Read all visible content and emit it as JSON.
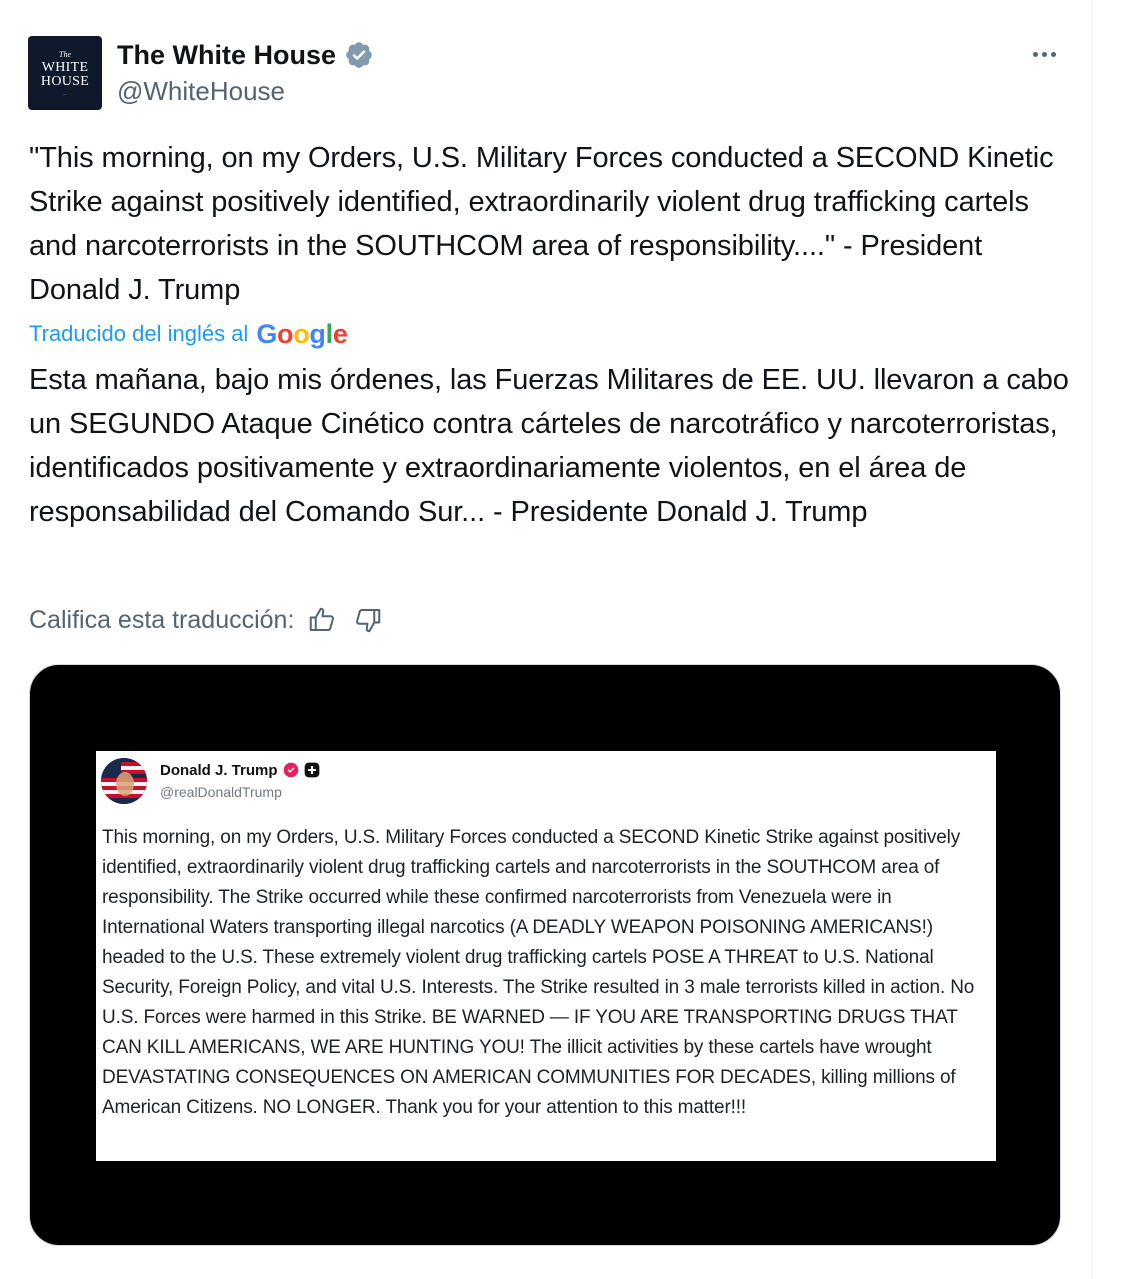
{
  "account": {
    "display_name": "The White House",
    "handle": "@WhiteHouse",
    "avatar_lines": [
      "The",
      "WHITE",
      "HOUSE"
    ],
    "verified_icon": "verified-badge-icon",
    "verified_color": "#829aab"
  },
  "post": {
    "text": "\"This morning, on my Orders, U.S. Military Forces conducted a SECOND Kinetic Strike against positively identified, extraordinarily violent drug trafficking cartels and narcoterrorists in the SOUTHCOM area of responsibility....\" - President Donald J. Trump",
    "translated_label": "Traducido del inglés al",
    "translation_provider": "Google",
    "translation": "Esta mañana, bajo mis órdenes, las Fuerzas Militares de EE. UU. llevaron a cabo un SEGUNDO Ataque Cinético contra cárteles de narcotráfico y narcoterroristas, identificados positivamente y extraordinariamente violentos, en el área de responsabilidad del Comando Sur... - Presidente Donald J. Trump",
    "rate_label": "Califica esta traducción:"
  },
  "media": {
    "name": "Donald J. Trump",
    "handle": "@realDonaldTrump",
    "text": "This morning, on my Orders, U.S. Military Forces conducted a SECOND Kinetic Strike against positively identified, extraordinarily violent drug trafficking cartels and narcoterrorists in the SOUTHCOM area of responsibility. The Strike occurred while these confirmed narcoterrorists from Venezuela were in International Waters transporting illegal narcotics (A DEADLY WEAPON POISONING AMERICANS!) headed to the U.S. These extremely violent drug trafficking cartels POSE A THREAT to U.S. National Security, Foreign Policy, and vital U.S. Interests. The Strike resulted in 3 male terrorists killed in action. No U.S. Forces were harmed in this Strike. BE WARNED — IF YOU ARE TRANSPORTING DRUGS THAT CAN KILL AMERICANS, WE ARE HUNTING YOU! The illicit activities by these cartels have wrought DEVASTATING CONSEQUENCES ON AMERICAN COMMUNITIES FOR DECADES, killing millions of American Citizens. NO LONGER. Thank you for your attention to this matter!!!",
    "verified_icon": "verified-badge-icon",
    "verified_color": "#e0245e"
  },
  "colors": {
    "link": "#1d9bf0",
    "secondary_text": "#536471",
    "primary_text": "#0f1419"
  }
}
